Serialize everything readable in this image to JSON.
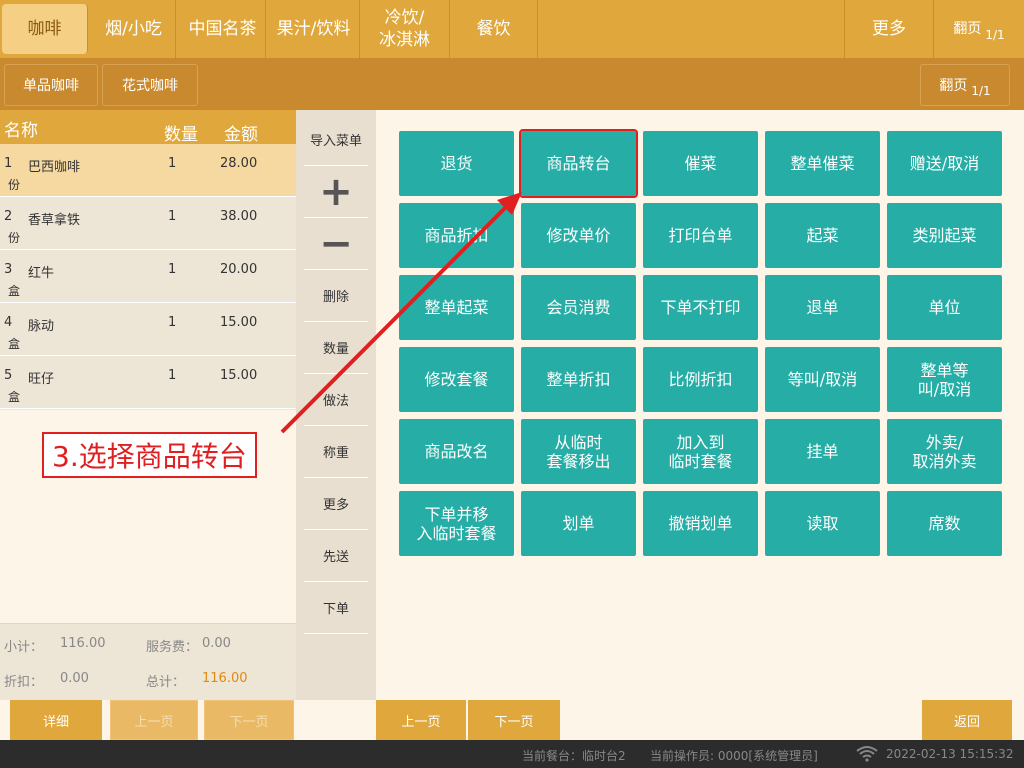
{
  "categories": [
    "咖啡",
    "烟/小吃",
    "中国名茶",
    "果汁/饮料",
    "冷饮/\n冰淇淋",
    "餐饮"
  ],
  "top_more": "更多",
  "top_pager": {
    "label": "翻页",
    "value": "1/1"
  },
  "subcategories": [
    "单品咖啡",
    "花式咖啡"
  ],
  "sub_pager": {
    "label": "翻页",
    "value": "1/1"
  },
  "order": {
    "headers": {
      "name": "名称",
      "qty": "数量",
      "amount": "金额"
    },
    "rows": [
      {
        "no": "1",
        "name": "巴西咖啡",
        "unit": "份",
        "qty": "1",
        "amount": "28.00"
      },
      {
        "no": "2",
        "name": "香草拿铁",
        "unit": "份",
        "qty": "1",
        "amount": "38.00"
      },
      {
        "no": "3",
        "name": "红牛",
        "unit": "盒",
        "qty": "1",
        "amount": "20.00"
      },
      {
        "no": "4",
        "name": "脉动",
        "unit": "盒",
        "qty": "1",
        "amount": "15.00"
      },
      {
        "no": "5",
        "name": "旺仔",
        "unit": "盒",
        "qty": "1",
        "amount": "15.00"
      }
    ],
    "subtotal_label": "小计：",
    "subtotal": "116.00",
    "service_label": "服务费：",
    "service": "0.00",
    "discount_label": "折扣：",
    "discount": "0.00",
    "total_label": "总计：",
    "total": "116.00"
  },
  "middle": {
    "import_menu": "导入菜单",
    "plus": "+",
    "minus": "−",
    "delete": "删除",
    "quantity": "数量",
    "method": "做法",
    "weigh": "称重",
    "more": "更多",
    "serve_first": "先送",
    "place_order": "下单"
  },
  "actions": [
    [
      "退货",
      "商品转台",
      "催菜",
      "整单催菜",
      "赠送/取消"
    ],
    [
      "商品折扣",
      "修改单价",
      "打印台单",
      "起菜",
      "类别起菜"
    ],
    [
      "整单起菜",
      "会员消费",
      "下单不打印",
      "退单",
      "单位"
    ],
    [
      "修改套餐",
      "整单折扣",
      "比例折扣",
      "等叫/取消",
      "整单等\n叫/取消"
    ],
    [
      "商品改名",
      "从临时\n套餐移出",
      "加入到\n临时套餐",
      "挂单",
      "外卖/\n取消外卖"
    ],
    [
      "下单并移\n入临时套餐",
      "划单",
      "撤销划单",
      "读取",
      "席数"
    ]
  ],
  "bottom": {
    "detail": "详细",
    "prev_page_left": "上一页",
    "next_page_left": "下一页",
    "prev_page": "上一页",
    "next_page": "下一页",
    "back": "返回"
  },
  "status": {
    "table": "当前餐台：临时台2",
    "operator": "当前操作员: 0000[系统管理员]",
    "datetime": "2022-02-13 15:15:32"
  },
  "annotation": "3.选择商品转台",
  "colors": {
    "accent": "#e0a83c",
    "teal": "#26ada5",
    "highlight": "#e02020"
  }
}
